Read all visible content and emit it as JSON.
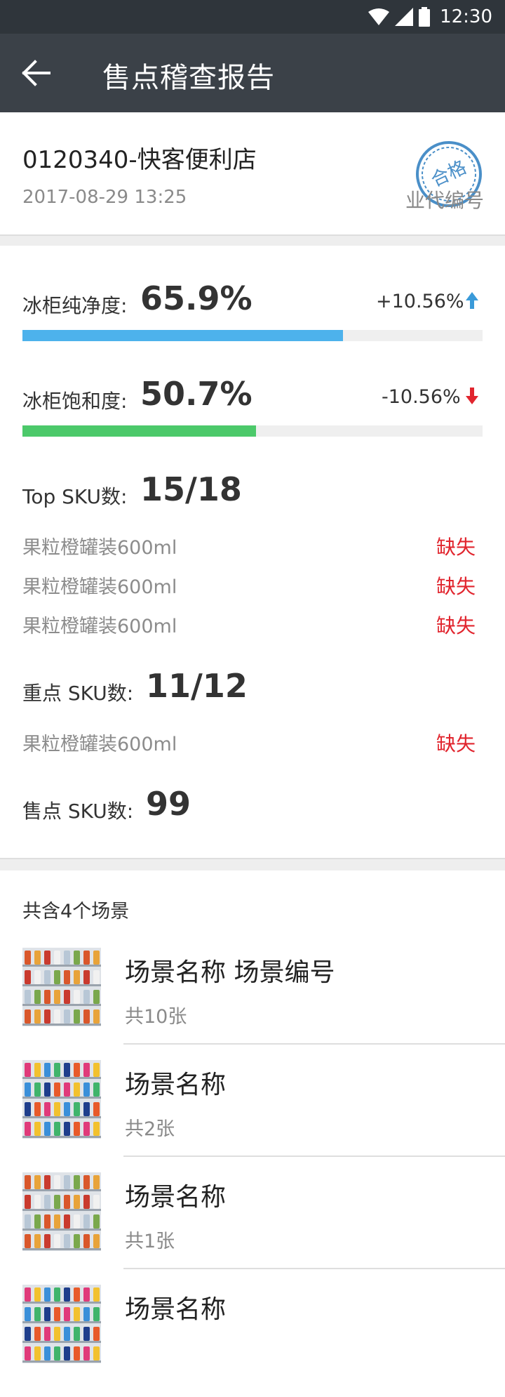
{
  "status_bar": {
    "time": "12:30",
    "icons": [
      "wifi-icon",
      "signal-icon",
      "battery-icon"
    ]
  },
  "app_bar": {
    "title": "售点稽查报告",
    "back_icon": "back-arrow-icon"
  },
  "store": {
    "name": "0120340-快客便利店",
    "datetime": "2017-08-29  13:25",
    "stamp_text": "合格",
    "tag": "业代编号"
  },
  "metrics": {
    "purity": {
      "label": "冰柜纯净度:",
      "value": "65.9%",
      "delta": "+10.56%",
      "trend": "up",
      "bar_fraction": 0.697,
      "bar_color": "#4db2ec"
    },
    "saturation": {
      "label": "冰柜饱和度:",
      "value": "50.7%",
      "delta": "-10.56%",
      "trend": "down",
      "bar_fraction": 0.507,
      "bar_color": "#4cc96a"
    }
  },
  "top_sku": {
    "label": "Top SKU数:",
    "value": "15/18",
    "items": [
      {
        "name": "果粒橙罐装600ml",
        "status": "缺失"
      },
      {
        "name": "果粒橙罐装600ml",
        "status": "缺失"
      },
      {
        "name": "果粒橙罐装600ml",
        "status": "缺失"
      }
    ]
  },
  "key_sku": {
    "label": "重点 SKU数:",
    "value": "11/12",
    "items": [
      {
        "name": "果粒橙罐装600ml",
        "status": "缺失"
      }
    ]
  },
  "store_sku": {
    "label": "售点 SKU数:",
    "value": "99"
  },
  "scenes": {
    "count_label": "共含4个场景",
    "items": [
      {
        "name": "场景名称 场景编号",
        "photos": "共10张",
        "thumb": "cooler-a"
      },
      {
        "name": "场景名称",
        "photos": "共2张",
        "thumb": "cooler-b"
      },
      {
        "name": "场景名称",
        "photos": "共1张",
        "thumb": "cooler-a"
      },
      {
        "name": "场景名称",
        "photos": "",
        "thumb": "cooler-b"
      }
    ]
  },
  "colors": {
    "up_arrow": "#3a9ad9",
    "down_arrow": "#e1252e",
    "missing": "#e1252e",
    "appbar": "#3b4148",
    "statusbar": "#2f353b"
  }
}
